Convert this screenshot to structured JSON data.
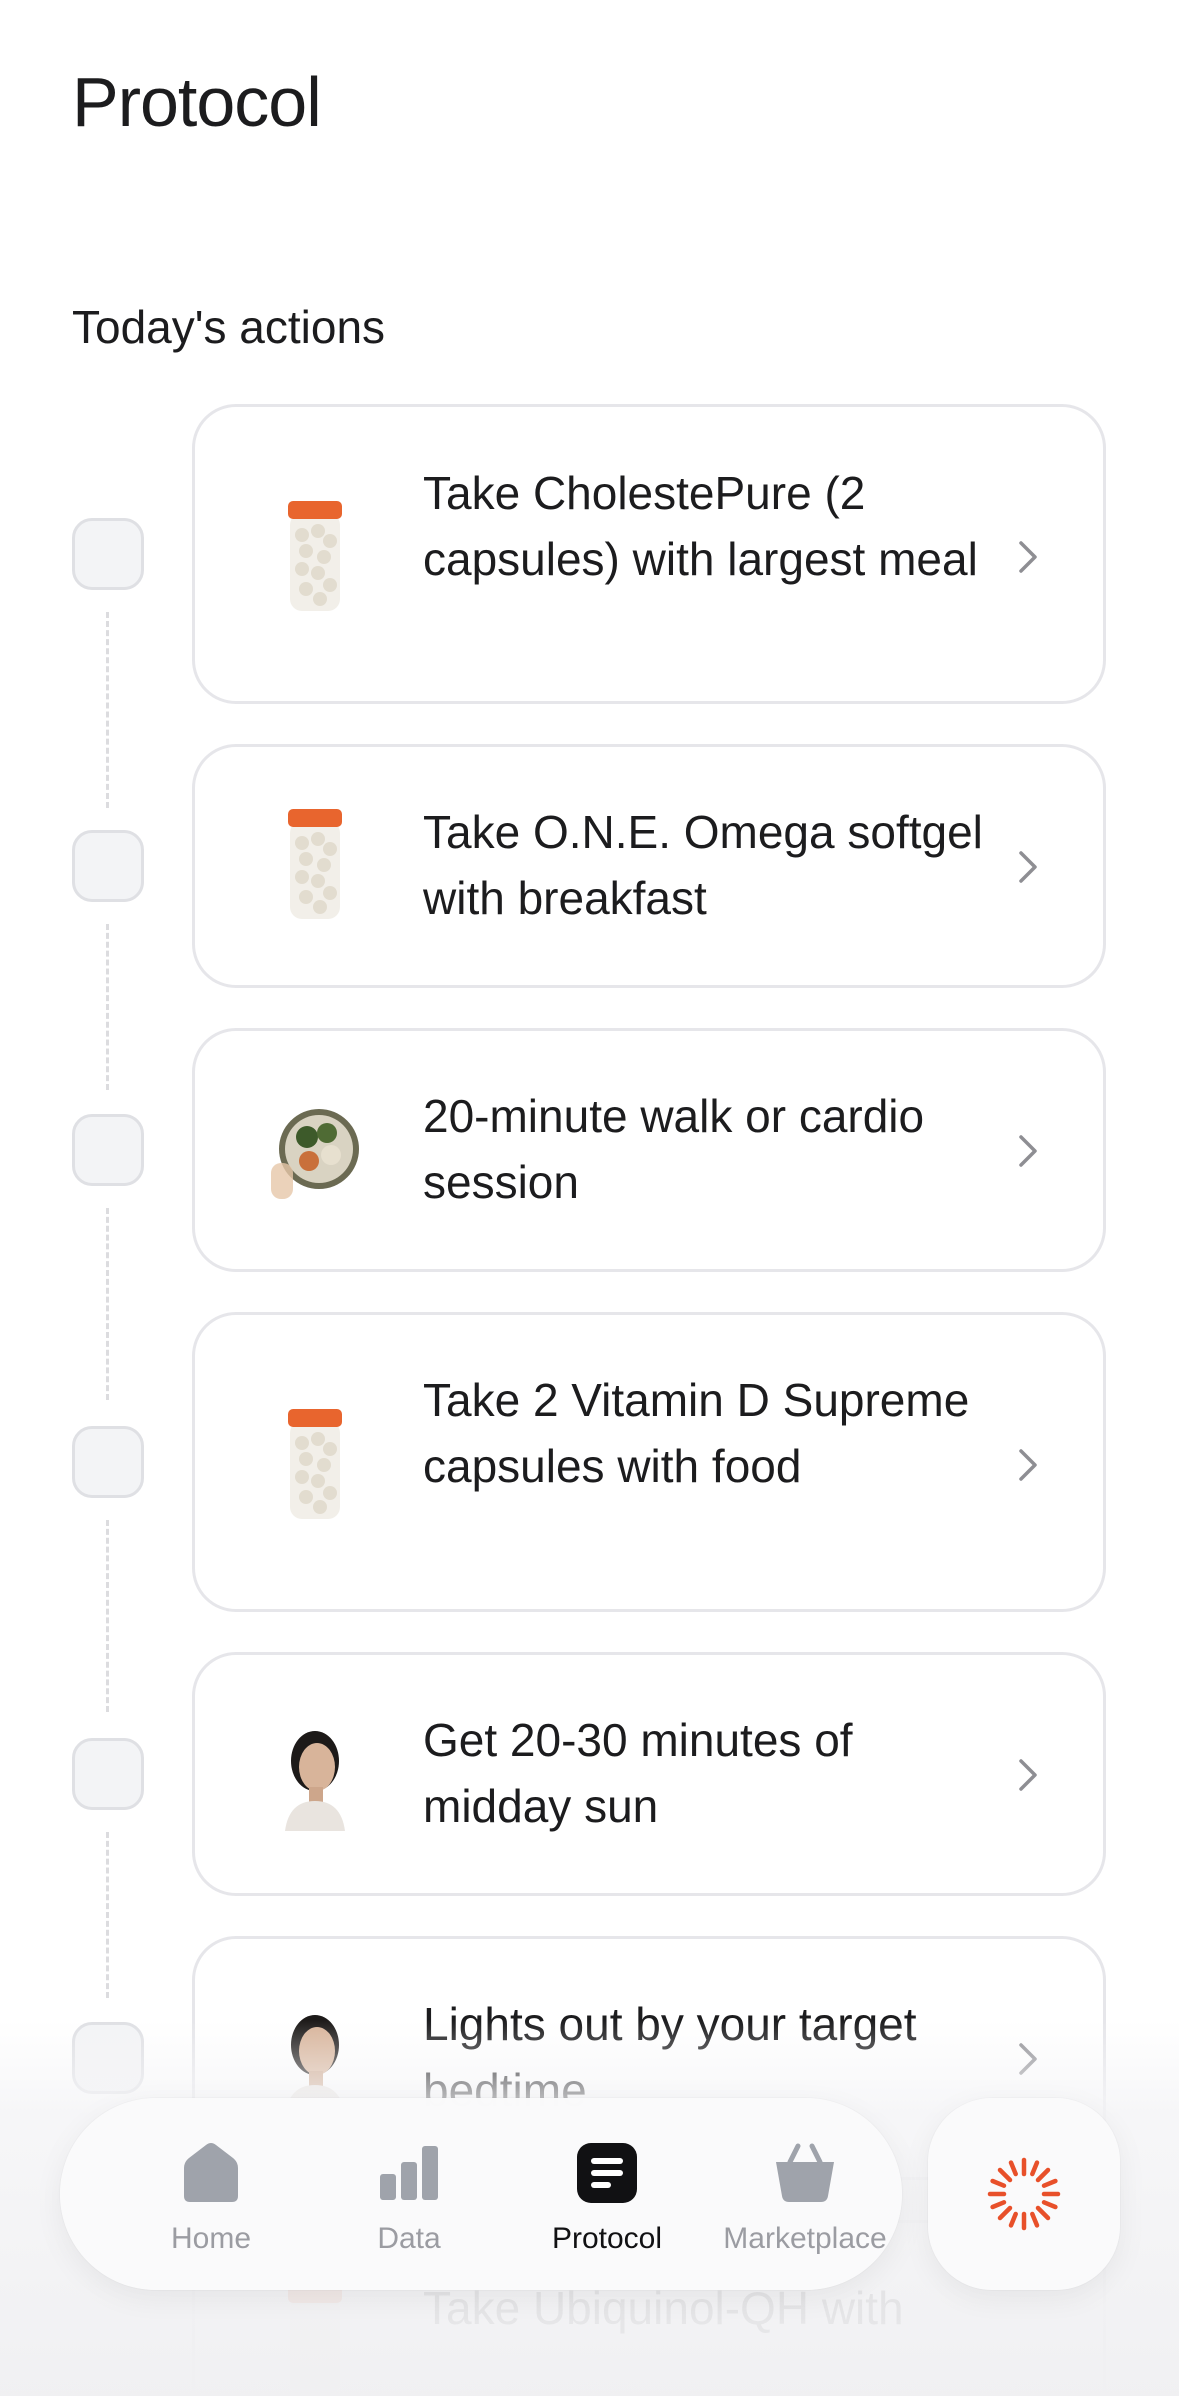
{
  "header": {
    "title": "Protocol"
  },
  "section": {
    "title": "Today's actions"
  },
  "actions": [
    {
      "text": "Take CholestePure (2 capsules) with largest meal",
      "icon": "supplement-bottle-image",
      "checked": false
    },
    {
      "text": "Take O.N.E. Omega softgel with breakfast",
      "icon": "supplement-bottle-image",
      "checked": false
    },
    {
      "text": "20-minute walk or cardio session",
      "icon": "healthy-food-bowl-image",
      "checked": false
    },
    {
      "text": "Take 2 Vitamin D Supreme capsules with food",
      "icon": "supplement-bottle-image",
      "checked": false
    },
    {
      "text": "Get 20-30 minutes of midday sun",
      "icon": "person-portrait-image",
      "checked": false
    },
    {
      "text": "Lights out by your target bedtime",
      "icon": "person-portrait-image",
      "checked": false
    },
    {
      "text": "Take Ubiquinol-QH with",
      "icon": "supplement-bottle-image",
      "checked": false
    }
  ],
  "tabbar": {
    "tabs": [
      {
        "label": "Home",
        "icon": "home-icon",
        "active": false
      },
      {
        "label": "Data",
        "icon": "bar-chart-icon",
        "active": false
      },
      {
        "label": "Protocol",
        "icon": "protocol-icon",
        "active": true
      },
      {
        "label": "Marketplace",
        "icon": "basket-icon",
        "active": false
      }
    ]
  },
  "assistant": {
    "icon": "sunburst-assistant-icon"
  },
  "colors": {
    "accent": "#e8502a",
    "bottle_cap": "#e8652e",
    "text": "#1c1c1e",
    "muted": "#9b9ca2",
    "card_border": "#e6e6ea"
  }
}
